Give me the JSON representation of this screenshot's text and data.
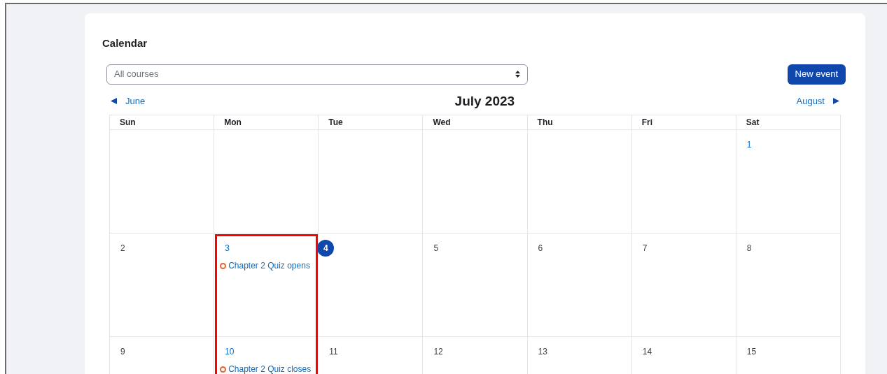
{
  "title": "Calendar",
  "course_select": {
    "value": "All courses"
  },
  "new_event_button": "New event",
  "nav": {
    "previous": "June",
    "current": "July 2023",
    "next": "August"
  },
  "weekdays": [
    "Sun",
    "Mon",
    "Tue",
    "Wed",
    "Thu",
    "Fri",
    "Sat"
  ],
  "weeks": [
    [
      {
        "kind": "blank"
      },
      {
        "kind": "blank"
      },
      {
        "kind": "blank"
      },
      {
        "kind": "blank"
      },
      {
        "kind": "blank"
      },
      {
        "kind": "blank"
      },
      {
        "kind": "day",
        "day": "1",
        "linked": true,
        "today": false
      }
    ],
    [
      {
        "kind": "day",
        "day": "2",
        "linked": false,
        "today": false
      },
      {
        "kind": "day",
        "day": "3",
        "linked": true,
        "today": false,
        "highlighted": true,
        "events": [
          {
            "title": "Chapter 2 Quiz opens",
            "color": "#e8622c"
          }
        ]
      },
      {
        "kind": "day",
        "day": "4",
        "linked": false,
        "today": true
      },
      {
        "kind": "day",
        "day": "5",
        "linked": false,
        "today": false
      },
      {
        "kind": "day",
        "day": "6",
        "linked": false,
        "today": false
      },
      {
        "kind": "day",
        "day": "7",
        "linked": false,
        "today": false
      },
      {
        "kind": "day",
        "day": "8",
        "linked": false,
        "today": false
      }
    ],
    [
      {
        "kind": "day",
        "day": "9",
        "linked": false,
        "today": false
      },
      {
        "kind": "day",
        "day": "10",
        "linked": true,
        "today": false,
        "highlighted": true,
        "events": [
          {
            "title": "Chapter 2 Quiz closes",
            "color": "#e8622c"
          }
        ]
      },
      {
        "kind": "day",
        "day": "11",
        "linked": false,
        "today": false
      },
      {
        "kind": "day",
        "day": "12",
        "linked": false,
        "today": false
      },
      {
        "kind": "day",
        "day": "13",
        "linked": false,
        "today": false
      },
      {
        "kind": "day",
        "day": "14",
        "linked": false,
        "today": false
      },
      {
        "kind": "day",
        "day": "15",
        "linked": false,
        "today": false
      }
    ]
  ]
}
